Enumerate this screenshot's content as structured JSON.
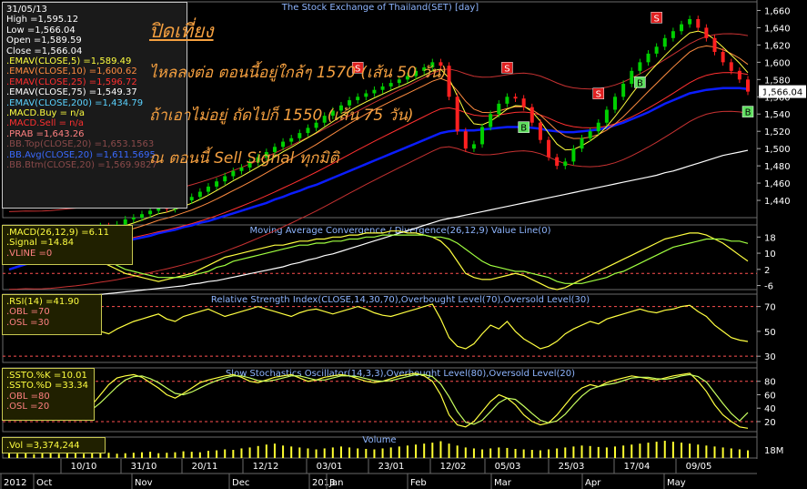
{
  "colors": {
    "price_up": "#00d000",
    "price_down": "#ff2020",
    "ema5": "#ffff40",
    "ema10": "#ff8c40",
    "ema25": "#ff3030",
    "ema50": "#0b1dff",
    "ema200": "#ffffff",
    "bb": "#c83232",
    "annotation": "#f5a040"
  },
  "chart_data": [
    {
      "type": "line",
      "title": "The Stock Exchange of Thailand(SET) [day]",
      "ylim": [
        1420,
        1670
      ],
      "yticks": [
        1440,
        1460,
        1480,
        1500,
        1520,
        1540,
        1560,
        1580,
        1600,
        1620,
        1640,
        1660
      ],
      "last_value_label": "1,566.04",
      "close": [
        1382,
        1385,
        1388,
        1380,
        1384,
        1390,
        1395,
        1398,
        1396,
        1402,
        1405,
        1410,
        1408,
        1412,
        1418,
        1420,
        1424,
        1428,
        1432,
        1430,
        1436,
        1440,
        1444,
        1450,
        1456,
        1462,
        1468,
        1474,
        1478,
        1484,
        1490,
        1496,
        1502,
        1508,
        1512,
        1518,
        1524,
        1530,
        1538,
        1544,
        1550,
        1556,
        1560,
        1564,
        1568,
        1572,
        1576,
        1580,
        1584,
        1590,
        1594,
        1600,
        1596,
        1560,
        1520,
        1500,
        1505,
        1525,
        1540,
        1552,
        1560,
        1558,
        1548,
        1530,
        1510,
        1490,
        1480,
        1485,
        1500,
        1512,
        1520,
        1530,
        1545,
        1560,
        1575,
        1590,
        1600,
        1610,
        1618,
        1628,
        1636,
        1644,
        1650,
        1640,
        1628,
        1612,
        1600,
        1590,
        1580,
        1566
      ],
      "ema50": [
        1360,
        1363,
        1366,
        1368,
        1370,
        1372,
        1375,
        1377,
        1379,
        1381,
        1384,
        1386,
        1388,
        1390,
        1392,
        1395,
        1397,
        1399,
        1402,
        1404,
        1406,
        1409,
        1411,
        1414,
        1416,
        1419,
        1422,
        1425,
        1428,
        1431,
        1434,
        1437,
        1441,
        1444,
        1448,
        1451,
        1455,
        1458,
        1462,
        1466,
        1470,
        1474,
        1478,
        1482,
        1486,
        1490,
        1494,
        1498,
        1502,
        1506,
        1510,
        1514,
        1518,
        1520,
        1521,
        1521,
        1521,
        1522,
        1523,
        1524,
        1525,
        1525,
        1525,
        1524,
        1523,
        1521,
        1520,
        1519,
        1519,
        1520,
        1521,
        1522,
        1524,
        1527,
        1530,
        1534,
        1538,
        1542,
        1547,
        1552,
        1556,
        1560,
        1564,
        1566,
        1568,
        1569,
        1570,
        1570,
        1570,
        1569
      ],
      "ema200": [
        1320,
        1321,
        1322,
        1323,
        1324,
        1325,
        1326,
        1327,
        1328,
        1329,
        1330,
        1331,
        1332,
        1333,
        1334,
        1335,
        1336,
        1337,
        1338,
        1339,
        1340,
        1341,
        1343,
        1344,
        1346,
        1347,
        1349,
        1351,
        1353,
        1355,
        1357,
        1359,
        1361,
        1363,
        1366,
        1368,
        1371,
        1373,
        1376,
        1378,
        1381,
        1384,
        1387,
        1390,
        1393,
        1396,
        1399,
        1402,
        1405,
        1408,
        1411,
        1414,
        1417,
        1419,
        1421,
        1423,
        1425,
        1427,
        1429,
        1431,
        1433,
        1435,
        1437,
        1439,
        1441,
        1443,
        1445,
        1447,
        1449,
        1451,
        1453,
        1455,
        1457,
        1459,
        1461,
        1463,
        1465,
        1467,
        1469,
        1472,
        1474,
        1477,
        1480,
        1483,
        1486,
        1489,
        1492,
        1494,
        1496,
        1498
      ]
    },
    {
      "type": "line",
      "title": "Moving Average Convergence / Divergence(26,12,9) Value Line(0)",
      "ylim": [
        -8,
        24
      ],
      "yticks": [
        -6,
        2,
        10,
        18
      ],
      "series": [
        {
          "name": "MACD(26,12,9)",
          "values": [
            6,
            7,
            8,
            9,
            10,
            11,
            12,
            12,
            11,
            10,
            8,
            6,
            4,
            2,
            0,
            -1,
            -2,
            -3,
            -4,
            -3,
            -2,
            -1,
            0,
            2,
            4,
            6,
            8,
            9,
            10,
            11,
            12,
            13,
            14,
            14,
            15,
            16,
            16,
            17,
            17,
            18,
            18,
            19,
            19,
            20,
            20,
            20,
            21,
            21,
            20,
            20,
            19,
            18,
            16,
            12,
            6,
            0,
            -2,
            -3,
            -3,
            -2,
            -1,
            0,
            -1,
            -3,
            -5,
            -7,
            -8,
            -7,
            -5,
            -3,
            -1,
            1,
            3,
            5,
            7,
            9,
            11,
            13,
            15,
            17,
            18,
            19,
            20,
            20,
            19,
            17,
            15,
            12,
            9,
            6.11
          ]
        },
        {
          "name": "Signal",
          "values": [
            5,
            6,
            7,
            8,
            9,
            10,
            10,
            11,
            11,
            10,
            9,
            8,
            6,
            4,
            2,
            1,
            0,
            -1,
            -2,
            -2,
            -2,
            -2,
            -1,
            0,
            1,
            3,
            4,
            6,
            7,
            8,
            9,
            10,
            11,
            12,
            13,
            14,
            14,
            15,
            15,
            16,
            16,
            17,
            17,
            18,
            18,
            19,
            19,
            19,
            19,
            19,
            19,
            18,
            18,
            17,
            15,
            12,
            9,
            6,
            4,
            3,
            2,
            1,
            1,
            0,
            -1,
            -2,
            -4,
            -5,
            -5,
            -5,
            -4,
            -3,
            -2,
            0,
            1,
            3,
            5,
            7,
            9,
            11,
            13,
            14,
            15,
            16,
            17,
            17,
            17,
            16,
            16,
            14.84
          ]
        }
      ]
    },
    {
      "type": "line",
      "title": "Relative Strength Index(CLOSE,14,30,70),Overbought Level(70),Oversold Level(30)",
      "ylim": [
        25,
        80
      ],
      "yticks": [
        30,
        50,
        70
      ],
      "series": [
        {
          "name": "RSI(14)",
          "values": [
            55,
            60,
            58,
            62,
            65,
            60,
            58,
            62,
            60,
            55,
            52,
            50,
            48,
            52,
            55,
            58,
            60,
            62,
            64,
            60,
            58,
            62,
            64,
            66,
            68,
            65,
            62,
            64,
            66,
            68,
            70,
            68,
            66,
            64,
            62,
            65,
            67,
            68,
            66,
            64,
            66,
            68,
            70,
            68,
            65,
            63,
            62,
            64,
            66,
            68,
            70,
            72,
            60,
            45,
            38,
            36,
            40,
            48,
            55,
            52,
            58,
            50,
            44,
            40,
            36,
            38,
            42,
            48,
            52,
            55,
            58,
            56,
            60,
            62,
            64,
            66,
            68,
            66,
            65,
            67,
            68,
            70,
            71,
            66,
            62,
            55,
            50,
            45,
            43,
            41.9
          ]
        }
      ]
    },
    {
      "type": "line",
      "title": "Slow Stochastics Oscillator(14,3,3),Overbought Level(80),Oversold Level(20)",
      "ylim": [
        5,
        100
      ],
      "yticks": [
        20,
        40,
        60,
        80
      ],
      "series": [
        {
          "name": "SSTO.%K",
          "values": [
            60,
            70,
            80,
            85,
            80,
            70,
            55,
            40,
            30,
            35,
            45,
            60,
            75,
            85,
            88,
            90,
            86,
            78,
            70,
            60,
            55,
            62,
            70,
            78,
            82,
            85,
            88,
            90,
            86,
            80,
            78,
            82,
            86,
            88,
            90,
            85,
            80,
            82,
            86,
            88,
            90,
            88,
            84,
            80,
            78,
            80,
            84,
            88,
            90,
            92,
            88,
            80,
            60,
            30,
            15,
            12,
            20,
            35,
            50,
            60,
            55,
            45,
            30,
            20,
            15,
            18,
            30,
            45,
            60,
            70,
            75,
            72,
            78,
            82,
            85,
            88,
            86,
            84,
            82,
            85,
            88,
            90,
            92,
            80,
            65,
            45,
            30,
            20,
            12,
            10.01
          ]
        },
        {
          "name": "SSTO.%D",
          "values": [
            55,
            62,
            70,
            78,
            82,
            78,
            68,
            55,
            42,
            36,
            38,
            48,
            60,
            72,
            82,
            87,
            88,
            84,
            78,
            70,
            62,
            60,
            64,
            70,
            76,
            81,
            85,
            88,
            88,
            85,
            81,
            80,
            82,
            85,
            88,
            88,
            85,
            82,
            82,
            85,
            88,
            88,
            87,
            84,
            81,
            80,
            81,
            84,
            87,
            90,
            90,
            87,
            76,
            57,
            35,
            19,
            16,
            22,
            35,
            48,
            55,
            53,
            43,
            32,
            22,
            18,
            21,
            31,
            45,
            58,
            68,
            72,
            75,
            77,
            81,
            85,
            86,
            86,
            84,
            83,
            85,
            88,
            90,
            87,
            79,
            63,
            47,
            32,
            21,
            33.34
          ]
        }
      ]
    },
    {
      "type": "bar",
      "title": "Volume",
      "yticks_label": "18M",
      "values": [
        10,
        9,
        11,
        8,
        10,
        12,
        9,
        10,
        11,
        9,
        10,
        12,
        11,
        9,
        10,
        11,
        12,
        13,
        10,
        11,
        12,
        14,
        13,
        12,
        15,
        16,
        18,
        17,
        20,
        22,
        25,
        28,
        30,
        26,
        24,
        22,
        20,
        18,
        20,
        22,
        24,
        22,
        20,
        19,
        18,
        20,
        22,
        24,
        26,
        28,
        30,
        32,
        35,
        30,
        26,
        22,
        20,
        18,
        20,
        22,
        21,
        19,
        18,
        17,
        16,
        18,
        20,
        22,
        24,
        26,
        25,
        23,
        22,
        24,
        26,
        28,
        30,
        32,
        34,
        36,
        34,
        32,
        30,
        28,
        26,
        24,
        22,
        20,
        18,
        16
      ]
    }
  ],
  "price_legend": {
    "date": "31/05/13",
    "high": "High  =1,595.12",
    "low": "Low   =1,566.04",
    "open": "Open  =1,589.59",
    "close": "Close  =1,566.04",
    "ema5": ".EMAV(CLOSE,5)   =1,589.49",
    "ema10": ".EMAV(CLOSE,10)  =1,600.62",
    "ema25": ".EMAV(CLOSE,25)  =1,596.72",
    "ema75": ".EMAV(CLOSE,75)  =1,549.37",
    "ema200": ".EMAV(CLOSE,200) =1,434.79",
    "macd_buy": ".MACD.Buy  = n/a",
    "macd_sell": ".MACD.Sell  = n/a",
    "prab": ".PRAB  =1,643.26",
    "bb_top": ".BB.Top(CLOSE,20)  =1,653.1563",
    "bb_avg": ".BB.Avg(CLOSE,20)  =1,611.5695",
    "bb_btm": ".BB.Btm(CLOSE,20)  =1,569.9827"
  },
  "macd_legend": {
    "macd": ".MACD(26,12,9)  =6.11",
    "signal": ".Signal  =14.84",
    "vline": ".VLINE  =0"
  },
  "rsi_legend": {
    "rsi": ".RSI(14)   =41.90",
    "obl": ".OBL  =70",
    "osl": ".OSL  =30"
  },
  "ssto_legend": {
    "k": ".SSTO.%K  =10.01",
    "d": ".SSTO.%D  =33.34",
    "obl": ".OBL  =80",
    "osl": ".OSL  =20"
  },
  "vol_legend": {
    "vol": ".Vol  =3,374,244"
  },
  "annotations": {
    "line1": "ปิดเที่ยง",
    "line2": "ไหลลงต่อ ตอนนี้อยู่ใกล้ๆ 1570 (เส้น 50 วัน)",
    "line3": "ถ้าเอาไม่อยู่ ถัดไปก็ 1550 (เส้น 75 วัน)",
    "line4": "ณ ตอนนี้ Sell Signal ทุกมิติ"
  },
  "signals": {
    "sell": "S",
    "buy": "B"
  },
  "x_axis": {
    "row1": [
      "10/10",
      "31/10",
      "20/11",
      "12/12",
      "03/01",
      "23/01",
      "12/02",
      "05/03",
      "25/03",
      "17/04",
      "09/05"
    ],
    "row2": [
      "2012",
      "Oct",
      "Nov",
      "Dec",
      "2013",
      "Jan",
      "Feb",
      "Mar",
      "Apr",
      "May"
    ]
  }
}
